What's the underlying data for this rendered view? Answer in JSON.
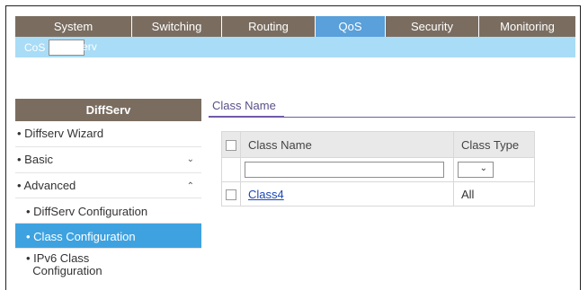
{
  "topnav": {
    "tabs": [
      {
        "label": "System"
      },
      {
        "label": "Switching"
      },
      {
        "label": "Routing"
      },
      {
        "label": "QoS"
      },
      {
        "label": "Security"
      },
      {
        "label": "Monitoring"
      }
    ]
  },
  "subnav": {
    "items": [
      {
        "label": "CoS"
      },
      {
        "label": "DiffServ"
      }
    ]
  },
  "sidebar": {
    "header": "DiffServ",
    "items": [
      {
        "label": "Diffserv Wizard"
      },
      {
        "label": "Basic",
        "chevron": "chevron-down-icon"
      },
      {
        "label": "Advanced",
        "chevron": "chevron-up-icon"
      },
      {
        "label": "DiffServ Configuration"
      },
      {
        "label": "Class Configuration"
      },
      {
        "label": "IPv6 Class",
        "label2": "Configuration"
      }
    ]
  },
  "main": {
    "section_title": "Class Name",
    "table": {
      "headers": [
        "Class Name",
        "Class Type"
      ],
      "rows": [
        {
          "class_name": "Class4",
          "class_type": "All"
        }
      ]
    }
  },
  "colors": {
    "topnav_bg": "#7a6d60",
    "active_tab": "#5aa0da",
    "subnav_bg": "#a9dcf6",
    "sidebar_active": "#3ea2e0",
    "section_title": "#5a4f89"
  }
}
